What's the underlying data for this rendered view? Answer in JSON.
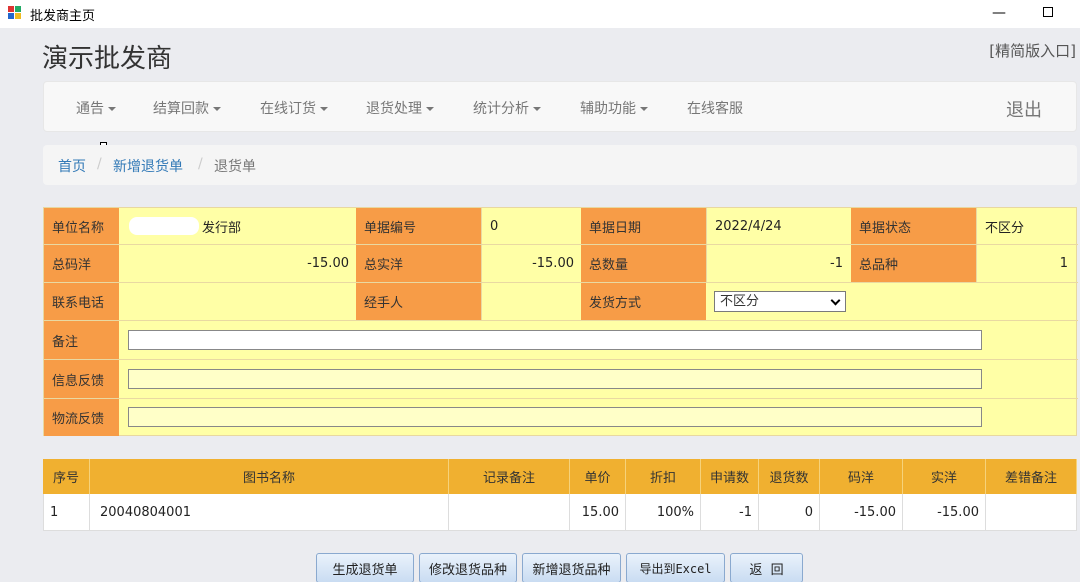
{
  "window": {
    "title": "批发商主页",
    "minimize": "—"
  },
  "app": {
    "title": "演示批发商",
    "simple_link": "[精简版入口]"
  },
  "nav": {
    "items": [
      "通告",
      "结算回款",
      "在线订货",
      "退货处理",
      "统计分析",
      "辅助功能",
      "在线客服"
    ],
    "logout": "退出"
  },
  "breadcrumb": {
    "home": "首页",
    "new_return": "新增退货单",
    "current": "退货单",
    "sep": "/"
  },
  "form": {
    "labels": {
      "unit": "单位名称",
      "doc_no": "单据编号",
      "doc_date": "单据日期",
      "doc_status": "单据状态",
      "total_code": "总码洋",
      "total_real": "总实洋",
      "total_qty": "总数量",
      "total_kinds": "总品种",
      "phone": "联系电话",
      "handler": "经手人",
      "ship_method": "发货方式",
      "remark": "备注",
      "info_feedback": "信息反馈",
      "logistics_feedback": "物流反馈"
    },
    "values": {
      "unit": "发行部",
      "doc_no": "0",
      "doc_date": "2022/4/24",
      "doc_status": "不区分",
      "total_code": "-15.00",
      "total_real": "-15.00",
      "total_qty": "-1",
      "total_kinds": "1",
      "phone": "",
      "handler": "",
      "ship_method": "不区分",
      "remark": "",
      "info_feedback": "",
      "logistics_feedback": ""
    }
  },
  "table": {
    "headers": [
      "序号",
      "图书名称",
      "记录备注",
      "单价",
      "折扣",
      "申请数",
      "退货数",
      "码洋",
      "实洋",
      "差错备注"
    ],
    "rows": [
      [
        "1",
        "20040804001",
        "",
        "15.00",
        "100%",
        "-1",
        "0",
        "-15.00",
        "-15.00",
        ""
      ]
    ]
  },
  "buttons": [
    "生成退货单",
    "修改退货品种",
    "新增退货品种",
    "导出到Excel",
    "返  回"
  ],
  "colors": {
    "label_bg": "#f79c47",
    "form_bg": "#ffffa6",
    "header_bg": "#f0b030",
    "link": "#337ab7"
  }
}
